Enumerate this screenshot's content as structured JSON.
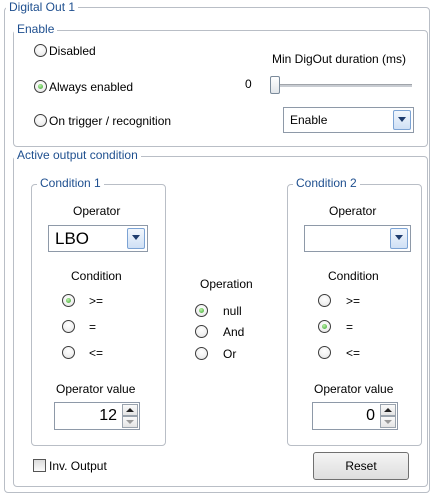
{
  "digital_out": {
    "title": "Digital Out 1",
    "enable": {
      "title": "Enable",
      "options": [
        "Disabled",
        "Always enabled",
        "On trigger / recognition"
      ],
      "selected": "Always enabled",
      "min_duration_label": "Min DigOut duration (ms)",
      "min_duration_value": "0",
      "slider_level": 0,
      "trigger_mode": "Enable"
    },
    "active_output": {
      "title": "Active output condition",
      "condition1": {
        "title": "Condition 1",
        "operator_label": "Operator",
        "operator_value": "LBO",
        "condition_label": "Condition",
        "conditions": [
          ">=",
          "=",
          "<="
        ],
        "selected": ">=",
        "operator_value_label": "Operator value",
        "value": "12"
      },
      "operation": {
        "label": "Operation",
        "options": [
          "null",
          "And",
          "Or"
        ],
        "selected": "null"
      },
      "condition2": {
        "title": "Condition 2",
        "operator_label": "Operator",
        "operator_value": "",
        "condition_label": "Condition",
        "conditions": [
          ">=",
          "=",
          "<="
        ],
        "selected": "=",
        "operator_value_label": "Operator value",
        "value": "0"
      }
    },
    "inv_output_label": "Inv. Output",
    "inv_output_checked": false,
    "reset_label": "Reset"
  }
}
